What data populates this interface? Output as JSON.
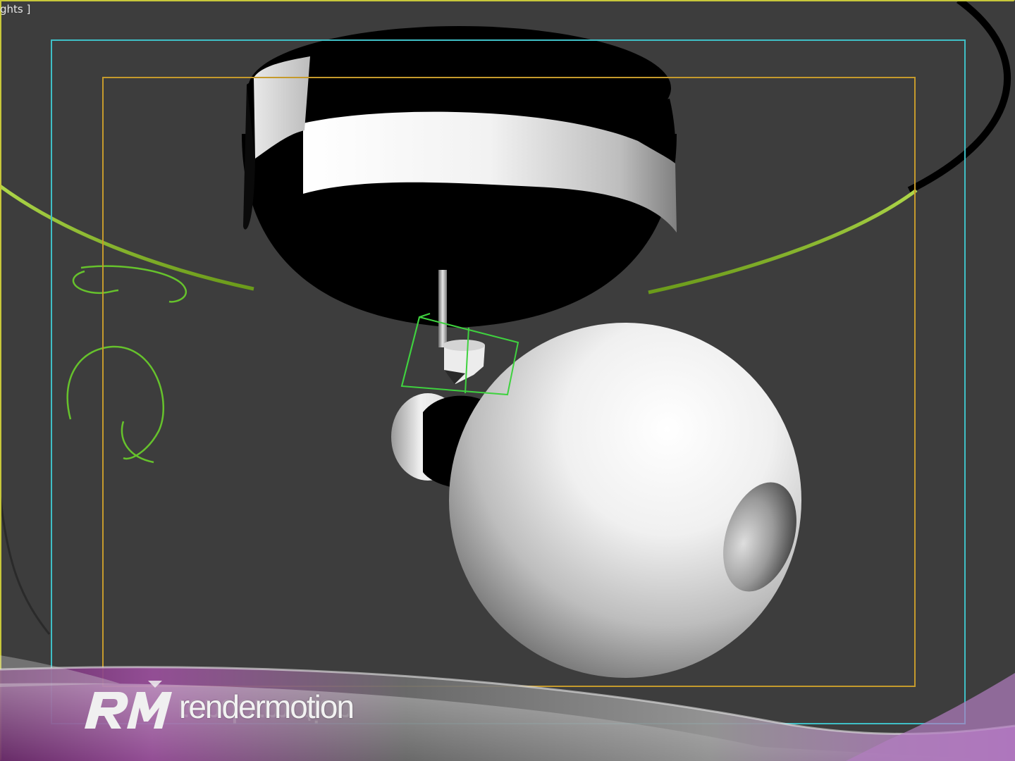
{
  "viewport": {
    "label": "ghts ]",
    "colors": {
      "active_border": "#c8c83a",
      "background": "#3d3d3d"
    }
  },
  "safe_frames": {
    "action_color": "#3fbfc6",
    "title_color": "#c59a2c"
  },
  "selection": {
    "gizmo_color": "#3fd23f"
  },
  "watermark": {
    "brand_name": "rendermotion",
    "logo_icon": "rm-logo-icon"
  }
}
